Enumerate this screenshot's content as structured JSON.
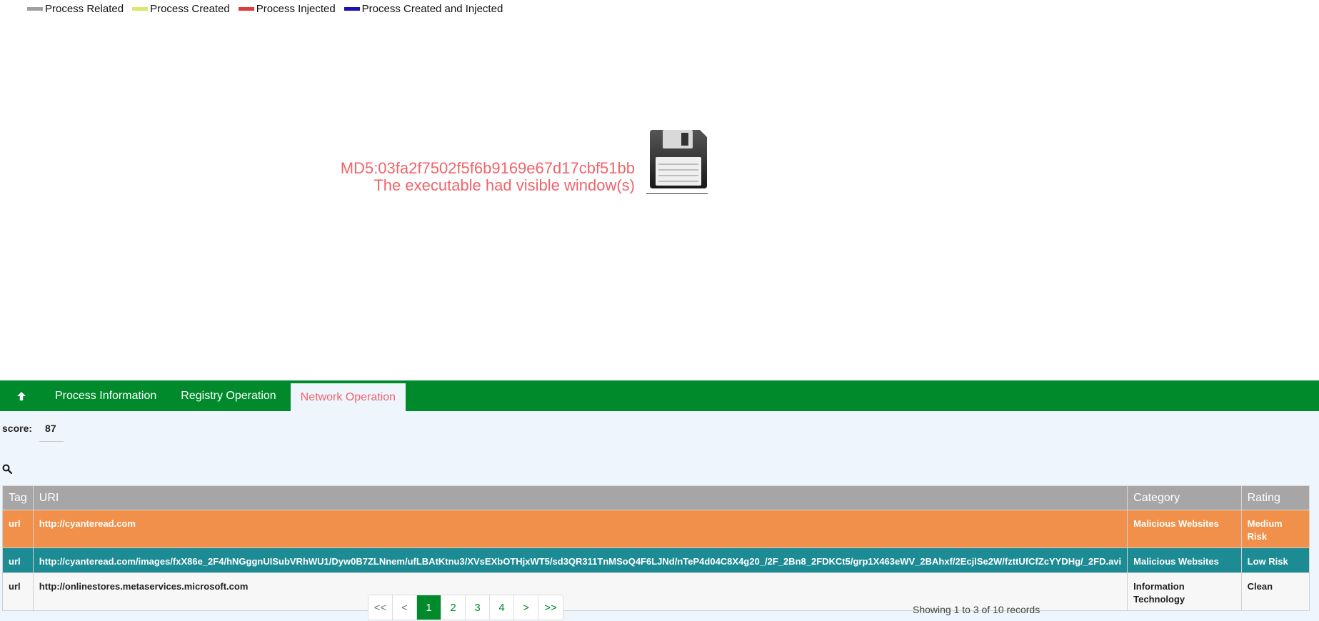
{
  "legend": [
    {
      "label": "Process Related",
      "color": "#a0a0a0"
    },
    {
      "label": "Process Created",
      "color": "#dbe86a"
    },
    {
      "label": "Process Injected",
      "color": "#e23b3b"
    },
    {
      "label": "Process Created and Injected",
      "color": "#1f0fb5"
    }
  ],
  "node": {
    "md5": "MD5:03fa2f7502f5f6b9169e67d17cbf51bb",
    "note": "The executable had visible window(s)",
    "icon": "floppy-disk-icon"
  },
  "tabs": {
    "up_icon": "arrow-up-icon",
    "items": [
      "Process Information",
      "Registry Operation",
      "Network Operation"
    ],
    "active": "Network Operation"
  },
  "score": {
    "label": "score:",
    "value": "87"
  },
  "table": {
    "headers": [
      "Tag",
      "URI",
      "Category",
      "Rating"
    ],
    "rows": [
      {
        "tag": "url",
        "uri": "http://cyanteread.com",
        "category": "Malicious Websites",
        "rating": "Medium Risk",
        "color": "#f0904a"
      },
      {
        "tag": "url",
        "uri": "http://cyanteread.com/images/fxX86e_2F4/hNGggnUISubVRhWU1/Dyw0B7ZLNnem/ufLBAtKtnu3/XVsEXbOTHjxWT5/sd3QR311TnMSoQ4F6LJNd/nTeP4d04C8X4g20_/2F_2Bn8_2FDKCt5/grp1X463eWV_2BAhxf/2EcjlSe2W/fzttUfCfZcYYDHg/_2FD.avi",
        "category": "Malicious Websites",
        "rating": "Low Risk",
        "color": "#1d8b94"
      },
      {
        "tag": "url",
        "uri": "http://onlinestores.metaservices.microsoft.com",
        "category": "Information Technology",
        "rating": "Clean",
        "color": "#f7f7f7"
      }
    ]
  },
  "pagination": {
    "first": "<<",
    "prev": "<",
    "pages": [
      "1",
      "2",
      "3",
      "4"
    ],
    "active": "1",
    "next": ">",
    "last": ">>",
    "summary": "Showing 1 to 3 of 10 records"
  }
}
